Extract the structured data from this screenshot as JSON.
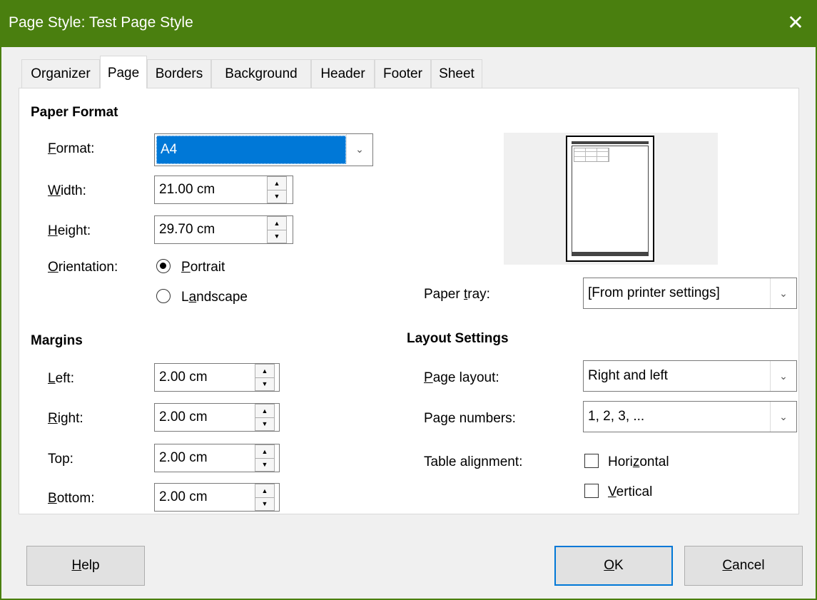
{
  "window": {
    "title": "Page Style: Test Page Style",
    "close_glyph": "✕"
  },
  "tabs": [
    "Organizer",
    "Page",
    "Borders",
    "Background",
    "Header",
    "Footer",
    "Sheet"
  ],
  "paper_format": {
    "heading": "Paper Format",
    "format_label": "Format:",
    "format_value": "A4",
    "width_label": "Width:",
    "width_value": "21.00 cm",
    "height_label": "Height:",
    "height_value": "29.70 cm",
    "orientation_label": "Orientation:",
    "portrait_label": "Portrait",
    "landscape_label": "Landscape"
  },
  "paper_tray": {
    "label": "Paper tray:",
    "value": "[From printer settings]"
  },
  "margins": {
    "heading": "Margins",
    "left_label": "Left:",
    "left_value": "2.00 cm",
    "right_label": "Right:",
    "right_value": "2.00 cm",
    "top_label": "Top:",
    "top_value": "2.00 cm",
    "bottom_label": "Bottom:",
    "bottom_value": "2.00 cm"
  },
  "layout": {
    "heading": "Layout Settings",
    "page_layout_label": "Page layout:",
    "page_layout_value": "Right and left",
    "page_numbers_label": "Page numbers:",
    "page_numbers_value": "1, 2, 3, ...",
    "table_alignment_label": "Table alignment:",
    "horizontal_label": "Horizontal",
    "vertical_label": "Vertical"
  },
  "buttons": {
    "help": "Help",
    "ok": "OK",
    "cancel": "Cancel"
  },
  "colors": {
    "titlebar": "#4a7f0f",
    "selection": "#0078d7",
    "default_button_border": "#0078d7"
  },
  "icons": [
    "close-icon",
    "spin-up-icon",
    "spin-down-icon",
    "chevron-down-icon",
    "radio-icon",
    "checkbox-icon"
  ]
}
